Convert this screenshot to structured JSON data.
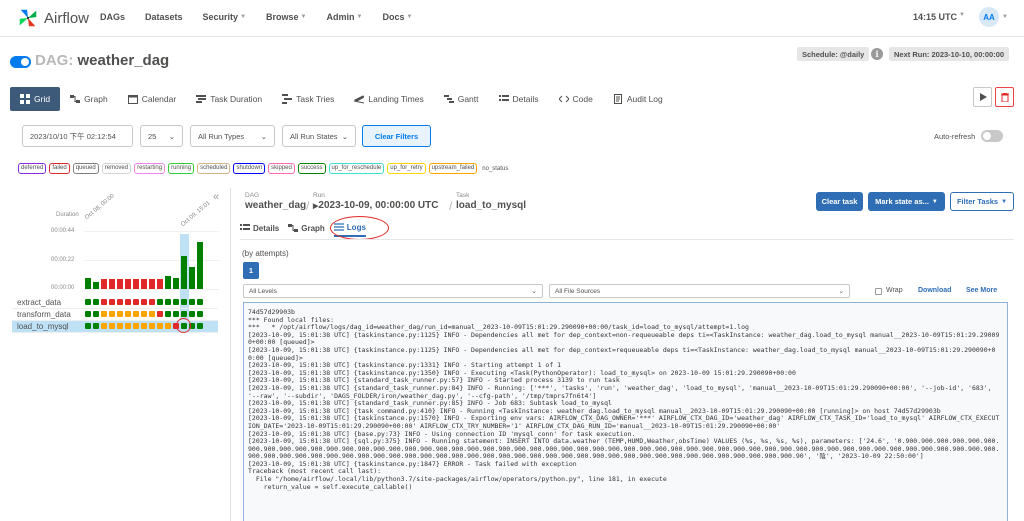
{
  "app": {
    "brand": "Airflow",
    "nav": [
      {
        "label": "DAGs",
        "caret": false
      },
      {
        "label": "Datasets",
        "caret": false
      },
      {
        "label": "Security",
        "caret": true
      },
      {
        "label": "Browse",
        "caret": true
      },
      {
        "label": "Admin",
        "caret": true
      },
      {
        "label": "Docs",
        "caret": true
      }
    ],
    "clock": "14:15 UTC",
    "avatar": "AA"
  },
  "dag": {
    "prefix": "DAG:",
    "name": "weather_dag",
    "schedule": "Schedule: @daily",
    "info_icon": "i",
    "next_run": "Next Run: 2023-10-10, 00:00:00"
  },
  "views": [
    {
      "label": "Grid",
      "icon": "grid-icon"
    },
    {
      "label": "Graph",
      "icon": "graph-icon"
    },
    {
      "label": "Calendar",
      "icon": "calendar-icon"
    },
    {
      "label": "Task Duration",
      "icon": "task-duration-icon"
    },
    {
      "label": "Task Tries",
      "icon": "task-tries-icon"
    },
    {
      "label": "Landing Times",
      "icon": "landing-times-icon"
    },
    {
      "label": "Gantt",
      "icon": "gantt-icon"
    },
    {
      "label": "Details",
      "icon": "details-icon"
    },
    {
      "label": "Code",
      "icon": "code-icon"
    },
    {
      "label": "Audit Log",
      "icon": "audit-log-icon"
    }
  ],
  "filters": {
    "date": "2023/10/10 下午 02:12:54",
    "count": "25",
    "run_types": "All Run Types",
    "run_states": "All Run States",
    "clear": "Clear Filters",
    "auto_refresh": "Auto-refresh"
  },
  "legend": [
    {
      "label": "deferred",
      "color": "#8a2be2"
    },
    {
      "label": "failed",
      "color": "#e02a2a"
    },
    {
      "label": "queued",
      "color": "#808080"
    },
    {
      "label": "removed",
      "color": "#d3d3d3"
    },
    {
      "label": "restarting",
      "color": "#ee82ee"
    },
    {
      "label": "running",
      "color": "#32cd32"
    },
    {
      "label": "scheduled",
      "color": "#d2b48c"
    },
    {
      "label": "shutdown",
      "color": "#0000ff"
    },
    {
      "label": "skipped",
      "color": "#ff69b4"
    },
    {
      "label": "success",
      "color": "#008000"
    },
    {
      "label": "up_for_reschedule",
      "color": "#40e0d0"
    },
    {
      "label": "up_for_retry",
      "color": "#ffd700"
    },
    {
      "label": "upstream_failed",
      "color": "#ffa500"
    },
    {
      "label": "no_status",
      "color": ""
    }
  ],
  "grid": {
    "duration_label": "Duration",
    "yticks": [
      "00:00:44",
      "00:00:22",
      "00:00:00"
    ],
    "date_labels": [
      "Oct 08, 00:00",
      "Oct 09, 15:01"
    ],
    "collapse_icon": "«",
    "run_states": [
      "success",
      "success",
      "failed",
      "failed",
      "failed",
      "failed",
      "failed",
      "failed",
      "failed",
      "failed",
      "success",
      "success",
      "success",
      "success",
      "success"
    ],
    "run_duration_fraction": [
      0.18,
      0.12,
      0.16,
      0.16,
      0.16,
      0.16,
      0.16,
      0.16,
      0.16,
      0.16,
      0.21,
      0.18,
      0.55,
      0.37,
      0.79
    ],
    "tasks": [
      {
        "label": "extract_data",
        "states": [
          "success",
          "success",
          "failed",
          "failed",
          "failed",
          "failed",
          "failed",
          "failed",
          "failed",
          "success",
          "success",
          "success",
          "success",
          "success",
          "success"
        ]
      },
      {
        "label": "transform_data",
        "states": [
          "success",
          "success",
          "upstream_failed",
          "upstream_failed",
          "upstream_failed",
          "upstream_failed",
          "upstream_failed",
          "upstream_failed",
          "upstream_failed",
          "failed",
          "success",
          "success",
          "success",
          "success",
          "success"
        ]
      },
      {
        "label": "load_to_mysql",
        "states": [
          "success",
          "success",
          "upstream_failed",
          "upstream_failed",
          "upstream_failed",
          "upstream_failed",
          "upstream_failed",
          "upstream_failed",
          "upstream_failed",
          "upstream_failed",
          "upstream_failed",
          "failed",
          "success",
          "success",
          "success"
        ]
      }
    ],
    "selected_index": 11
  },
  "breadcrumb": {
    "dag_small": "DAG",
    "dag": "weather_dag",
    "run_small": "Run",
    "run": "2023-10-09, 00:00:00 UTC",
    "task_small": "Task",
    "task": "load_to_mysql"
  },
  "actions": {
    "clear_task": "Clear task",
    "mark_state": "Mark state as...",
    "filter_tasks": "Filter Tasks"
  },
  "task_tabs": [
    {
      "label": "Details",
      "icon": "details-icon"
    },
    {
      "label": "Graph",
      "icon": "graph-icon"
    },
    {
      "label": "Logs",
      "icon": "logs-icon"
    }
  ],
  "logs": {
    "attempts_label": "(by attempts)",
    "attempt": "1",
    "levels": "All Levels",
    "sources": "All File Sources",
    "wrap": "Wrap",
    "download": "Download",
    "see_more": "See More",
    "lines": [
      "74d57d29903b",
      "*** Found local files:",
      "***   * /opt/airflow/logs/dag_id=weather_dag/run_id=manual__2023-10-09T15:01:29.290090+00:00/task_id=load_to_mysql/attempt=1.log",
      "[2023-10-09, 15:01:38 UTC] {taskinstance.py:1125} INFO - Dependencies all met for dep_context=non-requeueable deps ti=<TaskInstance: weather_dag.load_to_mysql manual__2023-10-09T15:01:29.290090+00:00 [queued]>",
      "[2023-10-09, 15:01:38 UTC] {taskinstance.py:1125} INFO - Dependencies all met for dep_context=requeueable deps ti=<TaskInstance: weather_dag.load_to_mysql manual__2023-10-09T15:01:29.290090+00:00 [queued]>",
      "[2023-10-09, 15:01:38 UTC] {taskinstance.py:1331} INFO - Starting attempt 1 of 1",
      "[2023-10-09, 15:01:38 UTC] {taskinstance.py:1350} INFO - Executing <Task(PythonOperator): load_to_mysql> on 2023-10-09 15:01:29.290090+00:00",
      "[2023-10-09, 15:01:38 UTC] {standard_task_runner.py:57} INFO - Started process 3139 to run task",
      "[2023-10-09, 15:01:38 UTC] {standard_task_runner.py:84} INFO - Running: ['***', 'tasks', 'run', 'weather_dag', 'load_to_mysql', 'manual__2023-10-09T15:01:29.290090+00:00', '--job-id', '683', '--raw', '--subdir', 'DAGS_FOLDER/iron/weather_dag.py', '--cfg-path', '/tmp/tmprs7fn6t4']",
      "[2023-10-09, 15:01:38 UTC] {standard_task_runner.py:85} INFO - Job 683: Subtask load_to_mysql",
      "[2023-10-09, 15:01:38 UTC] {task_command.py:410} INFO - Running <TaskInstance: weather_dag.load_to_mysql manual__2023-10-09T15:01:29.290090+00:00 [running]> on host 74d57d29903b",
      "[2023-10-09, 15:01:38 UTC] {taskinstance.py:1570} INFO - Exporting env vars: AIRFLOW_CTX_DAG_OWNER='***' AIRFLOW_CTX_DAG_ID='weather_dag' AIRFLOW_CTX_TASK_ID='load_to_mysql' AIRFLOW_CTX_EXECUTION_DATE='2023-10-09T15:01:29.290090+00:00' AIRFLOW_CTX_TRY_NUMBER='1' AIRFLOW_CTX_DAG_RUN_ID='manual__2023-10-09T15:01:29.290090+00:00'",
      "[2023-10-09, 15:01:38 UTC] {base.py:73} INFO - Using connection ID 'mysql_conn' for task execution.",
      "[2023-10-09, 15:01:38 UTC] {sql.py:375} INFO - Running statement: INSERT INTO data.weather (TEMP,HUMD,Weather,obsTime) VALUES (%s, %s, %s, %s), parameters: ['24.6', '0.900.900.900.900.900.900.900.900.900.900.900.900.900.900.900.900.900.900.900.900.900.900.900.900.900.900.900.900.900.900.900.900.900.900.900.900.900.900.900.900.900.900.900.900.900.900.900.900.900.900.900.900.900.900.900.900.900.900.900.900.900.900.900.900.900.900.900.900.900.900.900.900.900.900.900.900.900.900.900.900.900.900.900.900.900.900.900.900.900.90', '陰', '2023-10-09 22:50:00']",
      "[2023-10-09, 15:01:38 UTC] {taskinstance.py:1847} ERROR - Task failed with exception",
      "Traceback (most recent call last):",
      "  File \"/home/airflow/.local/lib/python3.7/site-packages/airflow/operators/python.py\", line 181, in execute",
      "    return_value = self.execute_callable()"
    ]
  }
}
